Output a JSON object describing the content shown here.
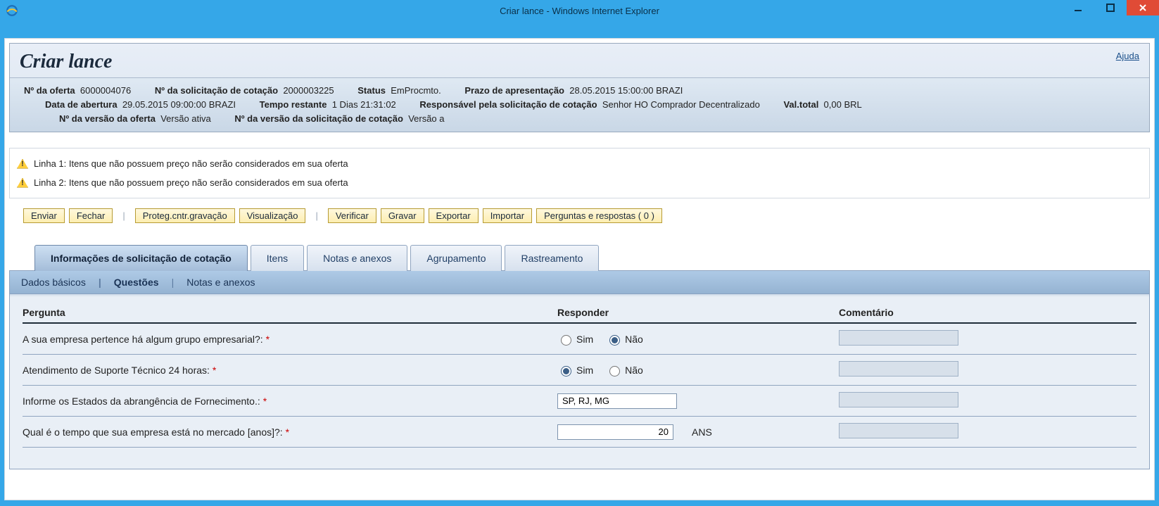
{
  "window": {
    "title": "Criar lance - Windows Internet Explorer"
  },
  "page": {
    "heading": "Criar lance",
    "help": "Ajuda"
  },
  "header": {
    "row1": [
      {
        "label": "Nº da oferta",
        "value": "6000004076"
      },
      {
        "label": "Nº da solicitação de cotação",
        "value": "2000003225"
      },
      {
        "label": "Status",
        "value": "EmProcmto."
      },
      {
        "label": "Prazo de apresentação",
        "value": "28.05.2015 15:00:00 BRAZI"
      }
    ],
    "row2": [
      {
        "label": "Data de abertura",
        "value": "29.05.2015 09:00:00 BRAZI"
      },
      {
        "label": "Tempo restante",
        "value": "1 Dias 21:31:02"
      },
      {
        "label": "Responsável pela solicitação de cotação",
        "value": "Senhor HO Comprador Decentralizado"
      },
      {
        "label": "Val.total",
        "value": "0,00 BRL"
      }
    ],
    "row3": [
      {
        "label": "Nº da versão da oferta",
        "value": "Versão ativa"
      },
      {
        "label": "Nº da versão da solicitação de cotação",
        "value": "Versão a"
      }
    ]
  },
  "warnings": [
    "Linha 1: Itens que não possuem preço não serão considerados em sua oferta",
    "Linha 2: Itens que não possuem preço não serão considerados em sua oferta"
  ],
  "toolbar": {
    "enviar": "Enviar",
    "fechar": "Fechar",
    "proteg": "Proteg.cntr.gravação",
    "visualizacao": "Visualização",
    "verificar": "Verificar",
    "gravar": "Gravar",
    "exportar": "Exportar",
    "importar": "Importar",
    "perguntas": "Perguntas e respostas ( 0 )"
  },
  "tabs": {
    "main": [
      "Informações de solicitação de cotação",
      "Itens",
      "Notas e anexos",
      "Agrupamento",
      "Rastreamento"
    ],
    "sub": [
      "Dados básicos",
      "Questões",
      "Notas e anexos"
    ]
  },
  "qtable": {
    "headers": {
      "q": "Pergunta",
      "r": "Responder",
      "c": "Comentário"
    },
    "options": {
      "sim": "Sim",
      "nao": "Não"
    },
    "rows": [
      {
        "text": "A sua empresa pertence há algum grupo empresarial?:",
        "type": "radio",
        "value": "nao"
      },
      {
        "text": "Atendimento de Suporte Técnico 24 horas:",
        "type": "radio",
        "value": "sim"
      },
      {
        "text": "Informe os Estados da abrangência de Fornecimento.:",
        "type": "text",
        "value": "SP, RJ, MG"
      },
      {
        "text": "Qual é o tempo que sua empresa está no mercado [anos]?:",
        "type": "number",
        "value": "20",
        "unit": "ANS"
      }
    ]
  }
}
